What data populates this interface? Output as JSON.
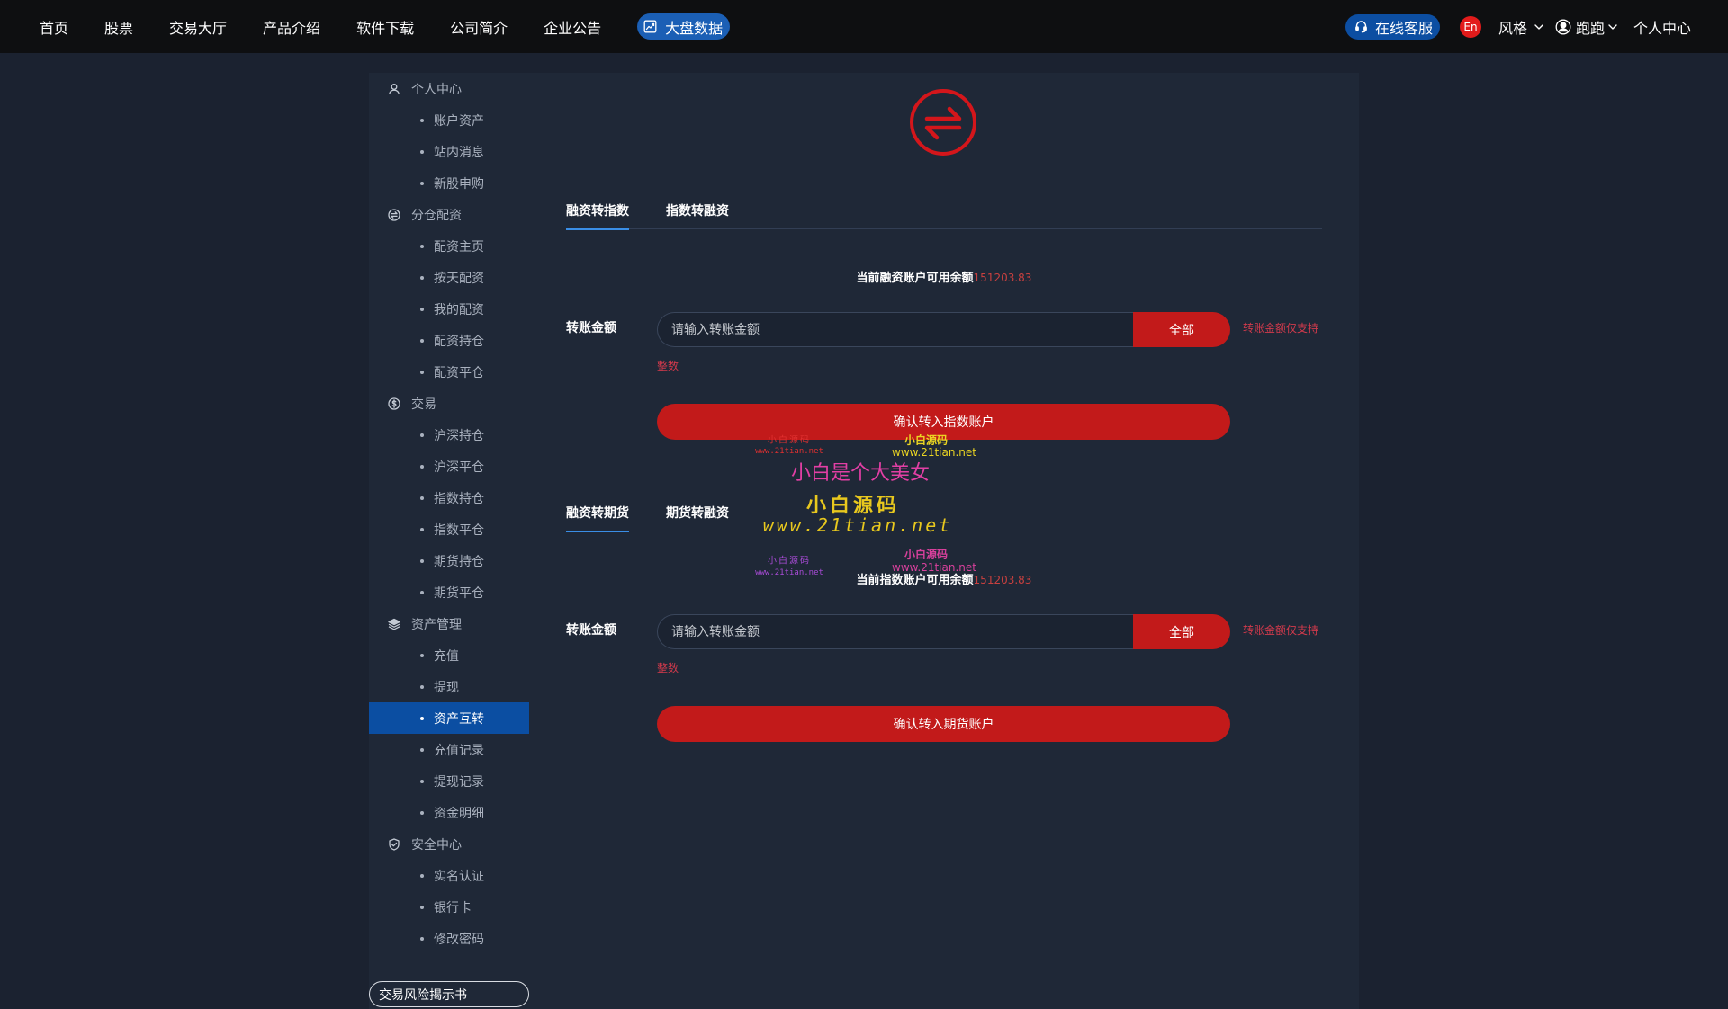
{
  "nav": {
    "items": [
      "首页",
      "股票",
      "交易大厅",
      "产品介绍",
      "软件下载",
      "公司简介",
      "企业公告"
    ],
    "market_data": "大盘数据",
    "service": "在线客服",
    "lang": "En",
    "style": "风格",
    "username": "跑跑",
    "personal_center": "个人中心",
    "icons": {
      "market_data": "chart-icon",
      "service": "headset-icon",
      "user": "user-circle-icon",
      "dropdown": "chevron-down-icon"
    }
  },
  "sidebar": {
    "groups": [
      {
        "title": "个人中心",
        "icon": "user-icon",
        "items": [
          {
            "label": "账户资产"
          },
          {
            "label": "站内消息"
          },
          {
            "label": "新股申购"
          }
        ]
      },
      {
        "title": "分仓配资",
        "icon": "exchange-circle-icon",
        "items": [
          {
            "label": "配资主页"
          },
          {
            "label": "按天配资"
          },
          {
            "label": "我的配资"
          },
          {
            "label": "配资持仓"
          },
          {
            "label": "配资平仓"
          }
        ]
      },
      {
        "title": "交易",
        "icon": "trade-coin-icon",
        "items": [
          {
            "label": "沪深持仓"
          },
          {
            "label": "沪深平仓"
          },
          {
            "label": "指数持仓"
          },
          {
            "label": "指数平仓"
          },
          {
            "label": "期货持仓"
          },
          {
            "label": "期货平仓"
          }
        ]
      },
      {
        "title": "资产管理",
        "icon": "layers-icon",
        "items": [
          {
            "label": "充值"
          },
          {
            "label": "提现"
          },
          {
            "label": "资产互转",
            "active": true
          },
          {
            "label": "充值记录"
          },
          {
            "label": "提现记录"
          },
          {
            "label": "资金明细"
          }
        ]
      },
      {
        "title": "安全中心",
        "icon": "shield-check-icon",
        "items": [
          {
            "label": "实名认证"
          },
          {
            "label": "银行卡"
          },
          {
            "label": "修改密码"
          }
        ]
      }
    ],
    "risk_disclosure": "交易风险揭示书"
  },
  "logo_icon": "exchange-logo-icon",
  "transfers": [
    {
      "tabs": [
        {
          "label": "融资转指数",
          "active": true
        },
        {
          "label": "指数转融资"
        }
      ],
      "balance_label": "当前融资账户可用余额",
      "balance_value": "151203.83",
      "amount_label": "转账金额",
      "placeholder": "请输入转账金额",
      "all_button": "全部",
      "hint": "转账金额仅支持",
      "hint_wrap": "整数",
      "confirm": "确认转入指数账户"
    },
    {
      "tabs": [
        {
          "label": "融资转期货",
          "active": true
        },
        {
          "label": "期货转融资"
        }
      ],
      "balance_label": "当前指数账户可用余额",
      "balance_value": "151203.83",
      "amount_label": "转账金额",
      "placeholder": "请输入转账金额",
      "all_button": "全部",
      "hint": "转账金额仅支持",
      "hint_wrap": "整数",
      "confirm": "确认转入期货账户"
    }
  ],
  "watermarks": [
    "小白源码",
    "www.21tian.net",
    "小白源码",
    "www.21tian.net",
    "小白是个大美女",
    "小白源码",
    "www.21tian.net",
    "小白源码",
    "www.21tian.net",
    "小白源码",
    "www.21tian.net"
  ],
  "colors": {
    "topbar_bg": "#0e0f11",
    "page_bg": "#1b2230",
    "panel_bg": "#1f2837",
    "accent_blue": "#1b5fb5",
    "active_item_bg": "#0b4ea2",
    "tab_underline": "#3a8ee6",
    "button_red": "#c21a1a",
    "hint_red": "#d23a4c",
    "balance_red": "#c8403f",
    "logo_red": "#d4161b"
  }
}
